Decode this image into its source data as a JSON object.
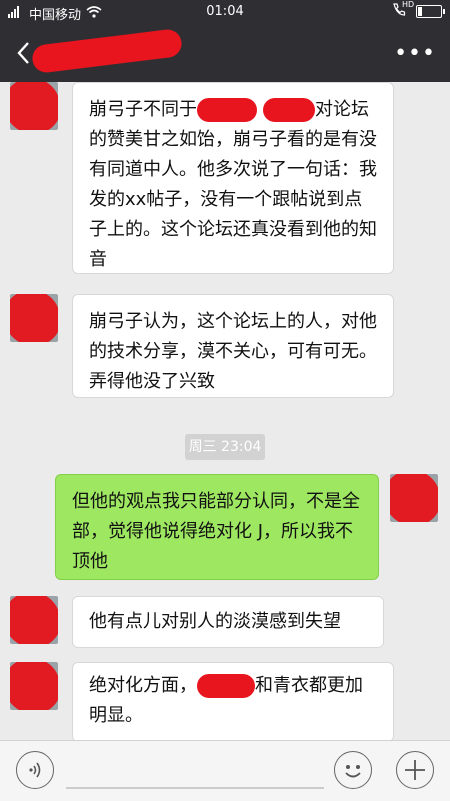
{
  "status_bar": {
    "carrier": "中国移动",
    "time": "01:04",
    "hd_label": "HD"
  },
  "nav": {
    "title": ""
  },
  "messages": [
    {
      "side": "left",
      "parts": [
        "崩弓子不同于",
        "",
        "",
        "对论坛的赞美甘之如饴，崩弓子看的是有没有同道中人。他多次说了一句话：我发的xx帖子，没有一个跟帖说到点子上的。这个论坛还真没看到他的知音"
      ]
    },
    {
      "side": "left",
      "text": "崩弓子认为，这个论坛上的人，对他的技术分享，漠不关心，可有可无。弄得他没了兴致"
    },
    {
      "side": "right",
      "text": "但他的观点我只能部分认同，不是全部，觉得他说得绝对化 J，所以我不顶他"
    },
    {
      "side": "left",
      "text": "他有点儿对别人的淡漠感到失望"
    },
    {
      "side": "left",
      "parts": [
        "绝对化方面，",
        "",
        "和青衣都更加明显。"
      ]
    }
  ],
  "timestamp": "周三 23:04",
  "colors": {
    "bar": "#2f2f33",
    "chat_bg": "#ebebeb",
    "my_bubble": "#9ee761",
    "redaction": "#e8141e"
  },
  "icons": [
    "back-arrow-icon",
    "more-icon",
    "voice-icon",
    "emoji-icon",
    "plus-icon",
    "wifi-icon",
    "signal-icon",
    "battery-icon"
  ]
}
